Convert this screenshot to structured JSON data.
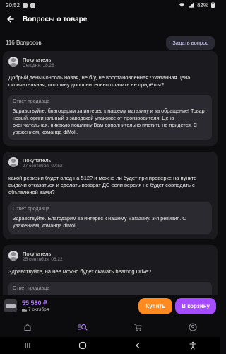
{
  "status_bar": {
    "time": "20:52",
    "battery": "82%"
  },
  "header": {
    "title": "Вопросы о товаре"
  },
  "summary": {
    "count_label": "116 Вопросов",
    "ask_button": "Задать вопрос"
  },
  "questions": [
    {
      "author": "Покупатель",
      "date": "Сегодня, 18:28",
      "text": "Добрый день!Консоль новая, не б/у, не восстановленная?Указанная цена окончательная, пошлину дополнительно платить не придётся?",
      "answer_label": "Ответ продавца",
      "answer": "Здравствуйте, благодарим за интерес к нашему магазину и за обращение! Товар новый, оригинальный в заводской упаковке от производителя. Цена окончательная, никакую пошлину Вам дополнительно платить не придется. С уважением, команда diMoll."
    },
    {
      "author": "Покупатель",
      "date": "27 сентября, 07:52",
      "text": "какой ревизии будет олед на 512? и можно ли будет при проверке на пункте выдачи отказаться и сделать возврат ДС если версия не будет совподать с объявленой вами?",
      "answer_label": "Ответ продавца",
      "answer": "Здравствуйте. Благодарим за интерес к нашему магазину.  3-я ревизия. С уважением, команда diMoll."
    },
    {
      "author": "Покупатель",
      "date": "25 сентября, 06:22",
      "text": "Здравствуйте, на нее можно будет скачать  beamng Drive?",
      "answer_label": "Ответ продавца",
      "answer": ""
    }
  ],
  "purchase_bar": {
    "price": "55 580 ₽",
    "delivery": "7 октября",
    "buy_label": "Купить",
    "cart_label": "В корзину"
  },
  "colors": {
    "accent": "#a64cff",
    "buy": "#ff8a1f",
    "price": "#b27bff"
  },
  "tabs": [
    "home-icon",
    "search-icon",
    "cart-icon",
    "profile-icon"
  ]
}
